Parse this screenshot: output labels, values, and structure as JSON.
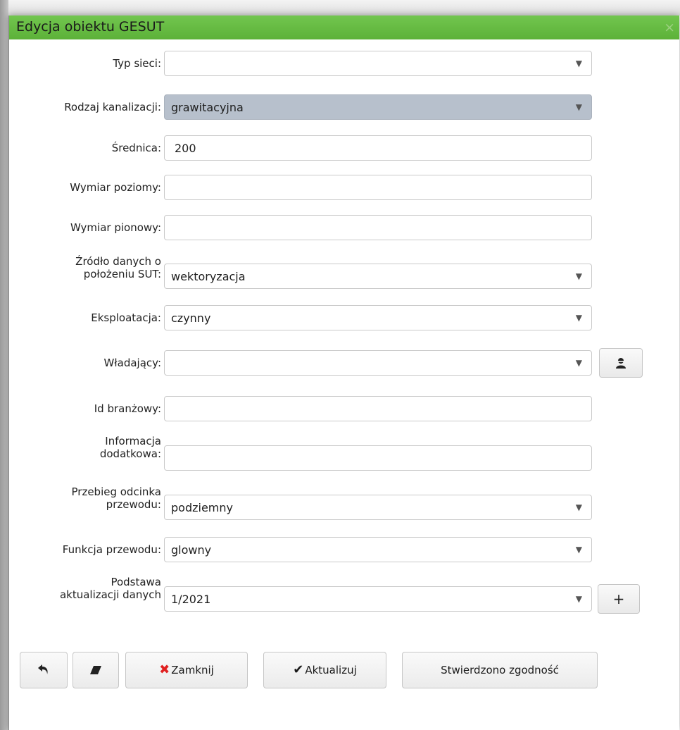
{
  "dialog": {
    "title": "Edycja obiektu GESUT",
    "close_glyph": "×"
  },
  "fields": {
    "typ_sieci": {
      "label": "Typ sieci:",
      "value": ""
    },
    "rodzaj_kanalizacji": {
      "label": "Rodzaj kanalizacji:",
      "value": "grawitacyjna"
    },
    "srednica": {
      "label": "Średnica:",
      "value": "200"
    },
    "wymiar_poziomy": {
      "label": "Wymiar poziomy:",
      "value": ""
    },
    "wymiar_pionowy": {
      "label": "Wymiar pionowy:",
      "value": ""
    },
    "zrodlo_danych": {
      "label_line1": "Źródło danych o",
      "label_line2": "położeniu SUT:",
      "value": "wektoryzacja"
    },
    "eksploatacja": {
      "label": "Eksploatacja:",
      "value": "czynny"
    },
    "wladajacy": {
      "label": "Władający:",
      "value": ""
    },
    "id_branzowy": {
      "label": "Id branżowy:",
      "value": ""
    },
    "informacja_dodatkowa": {
      "label_line1": "Informacja",
      "label_line2": "dodatkowa:",
      "value": ""
    },
    "przebieg_odcinka": {
      "label_line1": "Przebieg odcinka",
      "label_line2": "przewodu:",
      "value": "podziemny"
    },
    "funkcja_przewodu": {
      "label": "Funkcja przewodu:",
      "value": "glowny"
    },
    "podstawa_aktualizacji": {
      "label_line1": "Podstawa",
      "label_line2": "aktualizacji danych",
      "value": "1/2021"
    }
  },
  "icons": {
    "dropdown_caret": "▼",
    "person_picker": "person-icon",
    "add": "+",
    "undo": "undo-icon",
    "eraser": "eraser-icon",
    "close_x": "✖",
    "check": "✔"
  },
  "buttons": {
    "add_label": "+",
    "zamknij": "Zamknij",
    "aktualizuj": "Aktualizuj",
    "stwierdzono": "Stwierdzono zgodność"
  },
  "colors": {
    "titlebar": "#5fb53b",
    "selected_field": "#b7c0cc",
    "close_x": "#e02020"
  }
}
